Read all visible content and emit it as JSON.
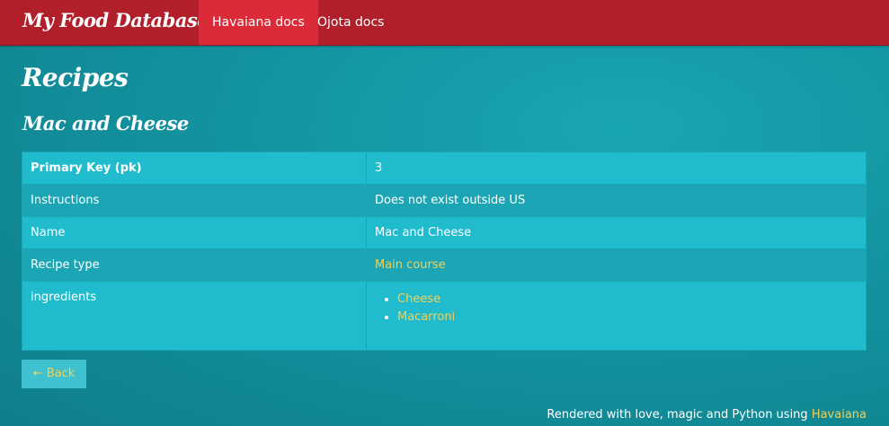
{
  "navbar": {
    "brand": "My Food Database",
    "links": [
      {
        "label": "Havaiana docs",
        "active": true
      },
      {
        "label": "Ojota docs",
        "active": false
      }
    ]
  },
  "page": {
    "title": "Recipes",
    "recipe_title": "Mac and Cheese"
  },
  "table": {
    "rows": [
      {
        "key": "Primary Key (pk)",
        "value": "3"
      },
      {
        "key": "Instructions",
        "value": "Does not exist outside US"
      },
      {
        "key": "Name",
        "value": "Mac and Cheese"
      },
      {
        "key": "Recipe type",
        "value": "Main course"
      },
      {
        "key": "ingredients",
        "items": [
          "Cheese",
          "Macarroni"
        ]
      }
    ]
  },
  "back_button": {
    "label": "← Back"
  },
  "footer": {
    "text": "Rendered with love, magic and Python using ",
    "link": "Havaiana"
  },
  "colors": {
    "navbar": "#b11f2a",
    "nav_active": "#dc2b38",
    "background": "#13939f",
    "table_row_odd": "#20bccd",
    "table_row_even": "#1ca6b5",
    "link": "#f0d15b"
  }
}
